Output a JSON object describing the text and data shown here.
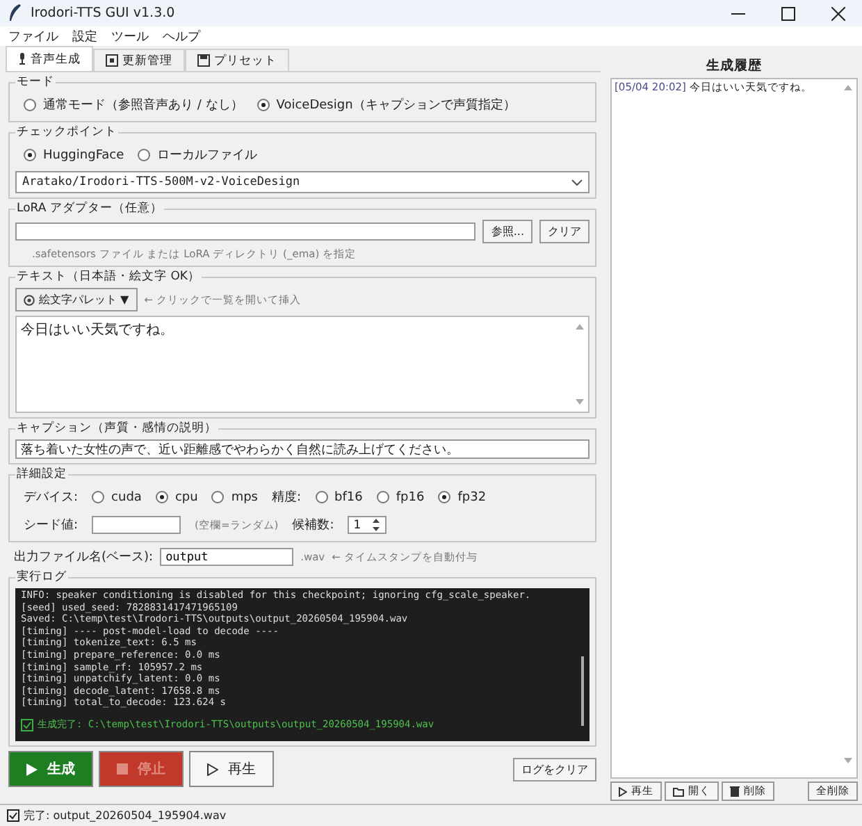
{
  "window": {
    "title": "Irodori-TTS GUI  v1.3.0"
  },
  "menu": [
    "ファイル",
    "設定",
    "ツール",
    "ヘルプ"
  ],
  "tabs": [
    {
      "label": "音声生成",
      "kind": "mic",
      "selected": true
    },
    {
      "label": "更新管理",
      "kind": "update",
      "selected": false
    },
    {
      "label": "プリセット",
      "kind": "preset",
      "selected": false
    }
  ],
  "mode": {
    "title": "モード",
    "options": [
      {
        "label": "通常モード（参照音声あり / なし）",
        "selected": false
      },
      {
        "label": "VoiceDesign（キャプションで声質指定）",
        "selected": true
      }
    ]
  },
  "checkpoint": {
    "title": "チェックポイント",
    "options": [
      {
        "label": "HuggingFace",
        "selected": true
      },
      {
        "label": "ローカルファイル",
        "selected": false
      }
    ],
    "model": "Aratako/Irodori-TTS-500M-v2-VoiceDesign"
  },
  "lora": {
    "title": "LoRA アダプター（任意）",
    "buttons": [
      "参照...",
      "クリア"
    ],
    "hint": ".safetensors ファイル または LoRA ディレクトリ (_ema) を指定"
  },
  "text": {
    "title": "テキスト（日本語・絵文字 OK）",
    "palette_button": "絵文字パレット ▼",
    "palette_hint": "← クリックで一覧を開いて挿入",
    "value": "今日はいい天気ですね。"
  },
  "caption": {
    "title": "キャプション（声質・感情の説明）",
    "value": "落ち着いた女性の声で、近い距離感でやわらかく自然に読み上げてください。"
  },
  "advanced": {
    "title": "詳細設定",
    "device_label": "デバイス:",
    "devices": [
      {
        "label": "cuda",
        "selected": false
      },
      {
        "label": "cpu",
        "selected": true
      },
      {
        "label": "mps",
        "selected": false
      }
    ],
    "precision_label": "精度:",
    "precisions": [
      {
        "label": "bf16",
        "selected": false
      },
      {
        "label": "fp16",
        "selected": false
      },
      {
        "label": "fp32",
        "selected": true
      }
    ],
    "seed_label": "シード値:",
    "seed_hint": "(空欄=ランダム)",
    "candidates_label": "候補数:",
    "candidates_value": "1"
  },
  "output": {
    "label": "出力ファイル名(ベース):",
    "value": "output",
    "suffix": ".wav",
    "hint": "← タイムスタンプを自動付与"
  },
  "log": {
    "title": "実行ログ",
    "lines": [
      "INFO: speaker conditioning is disabled for this checkpoint; ignoring cfg_scale_speaker.",
      "[seed] used_seed: 7828831417471965109",
      "Saved: C:\\temp\\test\\Irodori-TTS\\outputs\\output_20260504_195904.wav",
      "[timing] ---- post-model-load to decode ----",
      "[timing] tokenize_text: 6.5 ms",
      "[timing] prepare_reference: 0.0 ms",
      "[timing] sample_rf: 105957.2 ms",
      "[timing] unpatchify_latent: 0.0 ms",
      "[timing] decode_latent: 17658.8 ms",
      "[timing] total_to_decode: 123.624 s"
    ],
    "done_line": "生成完了: C:\\temp\\test\\Irodori-TTS\\outputs\\output_20260504_195904.wav"
  },
  "actions": [
    {
      "label": "生成",
      "kind": "generate",
      "disabled": false
    },
    {
      "label": "停止",
      "kind": "stop",
      "disabled": true
    },
    {
      "label": "再生",
      "kind": "play",
      "disabled": false
    }
  ],
  "clear_log": "ログをクリア",
  "history": {
    "title": "生成履歴",
    "items": [
      {
        "time": "[05/04 20:02]",
        "text": "今日はいい天気ですね。"
      }
    ],
    "buttons": [
      {
        "label": "再生",
        "kind": "play"
      },
      {
        "label": "開く",
        "kind": "open"
      },
      {
        "label": "削除",
        "kind": "delete"
      }
    ],
    "clear_all": "全削除"
  },
  "status": "完了: output_20260504_195904.wav"
}
